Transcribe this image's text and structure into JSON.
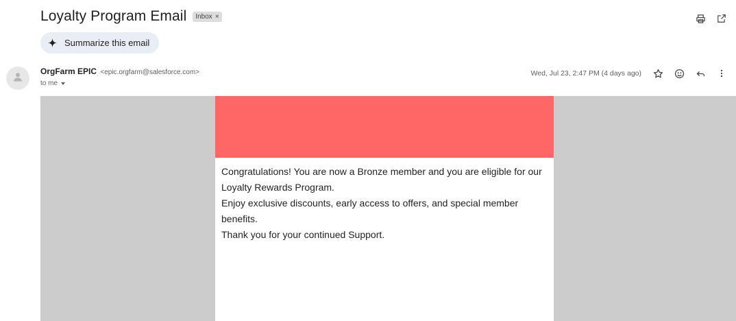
{
  "email": {
    "subject": "Loyalty Program Email",
    "label": "Inbox",
    "label_remove": "×",
    "summarize_label": "Summarize this email",
    "sender_name": "OrgFarm EPIC",
    "sender_address": "<epic.orgfarm@salesforce.com>",
    "recipient": "to me",
    "date": "Wed, Jul 23, 2:47 PM (4 days ago)"
  },
  "icons": {
    "print": "printer-icon",
    "popout": "open-in-new-window-icon",
    "summarize": "sparkle-icon",
    "avatar": "person-icon",
    "star": "star-icon",
    "emoji": "emoji-icon",
    "reply": "reply-icon",
    "more": "more-vertical-icon"
  },
  "message": {
    "lines": [
      "Congratulations! You are now a Bronze member and you are eligible for our Loyalty Rewards Program.",
      "Enjoy exclusive discounts, early access to offers, and special member benefits.",
      "Thank you for your continued Support."
    ]
  },
  "colors": {
    "hero": "#ff6666",
    "frame": "#cccccc",
    "summarize_bg": "#e9eef6"
  }
}
